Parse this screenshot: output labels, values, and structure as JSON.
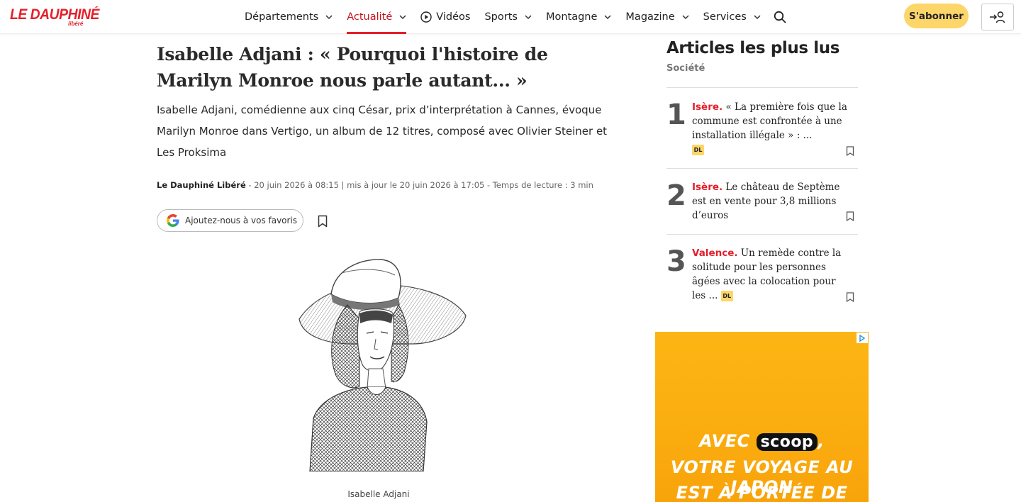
{
  "header": {
    "logo_main": "LE DAUPHINÉ",
    "logo_sub": "libéré",
    "nav": [
      {
        "label": "Départements",
        "dropdown": true,
        "active": false
      },
      {
        "label": "Actualité",
        "dropdown": true,
        "active": true
      },
      {
        "label": "Vidéos",
        "dropdown": false,
        "active": false,
        "icon": "play-icon"
      },
      {
        "label": "Sports",
        "dropdown": true,
        "active": false
      },
      {
        "label": "Montagne",
        "dropdown": true,
        "active": false
      },
      {
        "label": "Magazine",
        "dropdown": true,
        "active": false
      },
      {
        "label": "Services",
        "dropdown": true,
        "active": false
      }
    ],
    "subscribe_label": "S'abonner"
  },
  "article": {
    "title": "Isabelle Adjani : « Pourquoi l'histoire de Marilyn Monroe nous parle autant... »",
    "lead": "Isabelle Adjani, comédienne aux cinq César, prix d’interprétation à Cannes, évoque Marilyn Monroe dans Vertigo, un album de 12 titres, composé avec Olivier Steiner et Les Proksima",
    "author": "Le Dauphiné Libéré",
    "meta_rest": " - 20 juin 2026 à 08:15 | mis à jour le 20 juin 2026 à 17:05 - Temps de lecture : 3 min",
    "favorite_label": "Ajoutez-nous à vos favoris",
    "caption": "Isabelle Adjani"
  },
  "sidebar": {
    "title": "Articles les plus lus",
    "category": "Société",
    "items": [
      {
        "rank": "1",
        "city": "Isère.",
        "text": " « La première fois que la commune est confrontée à une installation illégale » : ...",
        "badge": "DL"
      },
      {
        "rank": "2",
        "city": "Isère.",
        "text": " Le château de Septème est en vente pour 3,8 millions d’euros",
        "badge": ""
      },
      {
        "rank": "3",
        "city": "Valence.",
        "text": " Un remède contre la solitude pour les personnes âgées avec la colocation pour les ...",
        "badge": "DL"
      }
    ]
  },
  "ad": {
    "line1_a": "AVEC",
    "line1_brand": "scoop",
    "line1_b": ",",
    "line2": "VOTRE VOYAGE AU JAPON",
    "line3": "EST À PORTÉE DE CLIC!"
  },
  "colors": {
    "brand_red": "#e4202b",
    "subscribe_yellow": "#fcd669",
    "ad_orange": "#fbae10"
  }
}
